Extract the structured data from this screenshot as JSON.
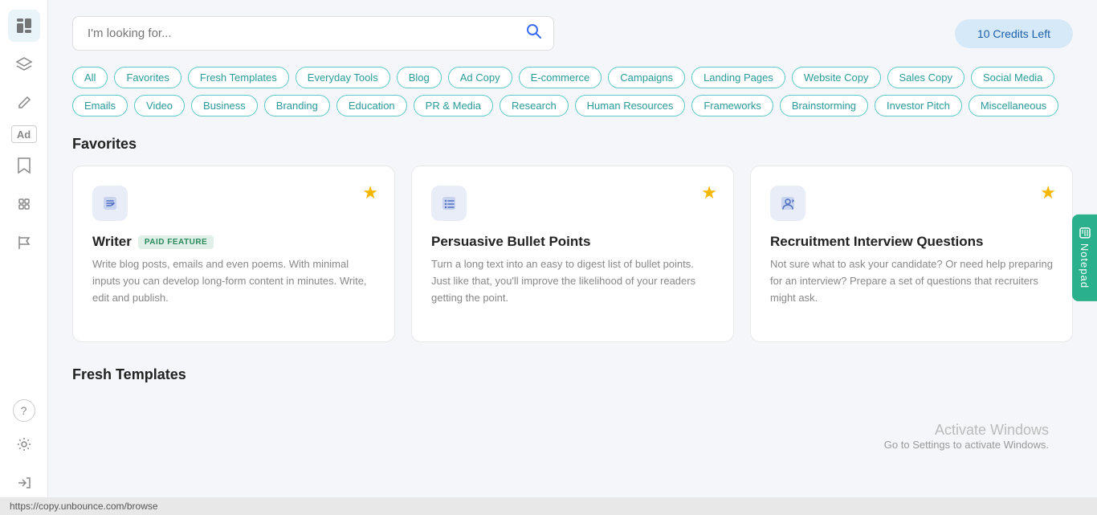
{
  "sidebar": {
    "items": [
      {
        "name": "dashboard-icon",
        "icon": "☰",
        "active": true,
        "label": "Dashboard"
      },
      {
        "name": "layers-icon",
        "icon": "⊞",
        "active": false,
        "label": "Layers"
      },
      {
        "name": "edit-icon",
        "icon": "✏️",
        "active": false,
        "label": "Edit"
      },
      {
        "name": "ad-icon",
        "icon": "Ad",
        "active": false,
        "label": "Ad"
      },
      {
        "name": "bookmark-icon",
        "icon": "🔖",
        "active": false,
        "label": "Bookmark"
      },
      {
        "name": "plugin-icon",
        "icon": "🧩",
        "active": false,
        "label": "Plugin"
      },
      {
        "name": "flag-icon",
        "icon": "🚩",
        "active": false,
        "label": "Flag"
      }
    ],
    "bottom_items": [
      {
        "name": "help-icon",
        "icon": "?",
        "label": "Help"
      },
      {
        "name": "settings-icon",
        "icon": "⚙",
        "label": "Settings"
      },
      {
        "name": "logout-icon",
        "icon": "→",
        "label": "Logout"
      }
    ]
  },
  "search": {
    "placeholder": "I'm looking for...",
    "value": ""
  },
  "credits": {
    "label": "10 Credits Left"
  },
  "filter_tags": [
    {
      "id": "all",
      "label": "All",
      "active": false
    },
    {
      "id": "favorites",
      "label": "Favorites",
      "active": false
    },
    {
      "id": "fresh-templates",
      "label": "Fresh Templates",
      "active": false
    },
    {
      "id": "everyday-tools",
      "label": "Everyday Tools",
      "active": false
    },
    {
      "id": "blog",
      "label": "Blog",
      "active": false
    },
    {
      "id": "ad-copy",
      "label": "Ad Copy",
      "active": false
    },
    {
      "id": "e-commerce",
      "label": "E-commerce",
      "active": false
    },
    {
      "id": "campaigns",
      "label": "Campaigns",
      "active": false
    },
    {
      "id": "landing-pages",
      "label": "Landing Pages",
      "active": false
    },
    {
      "id": "website-copy",
      "label": "Website Copy",
      "active": false
    },
    {
      "id": "sales-copy",
      "label": "Sales Copy",
      "active": false
    },
    {
      "id": "social-media",
      "label": "Social Media",
      "active": false
    },
    {
      "id": "emails",
      "label": "Emails",
      "active": false
    },
    {
      "id": "video",
      "label": "Video",
      "active": false
    },
    {
      "id": "business",
      "label": "Business",
      "active": false
    },
    {
      "id": "branding",
      "label": "Branding",
      "active": false
    },
    {
      "id": "education",
      "label": "Education",
      "active": false
    },
    {
      "id": "pr-media",
      "label": "PR & Media",
      "active": false
    },
    {
      "id": "research",
      "label": "Research",
      "active": false
    },
    {
      "id": "human-resources",
      "label": "Human Resources",
      "active": false
    },
    {
      "id": "frameworks",
      "label": "Frameworks",
      "active": false
    },
    {
      "id": "brainstorming",
      "label": "Brainstorming",
      "active": false
    },
    {
      "id": "investor-pitch",
      "label": "Investor Pitch",
      "active": false
    },
    {
      "id": "miscellaneous",
      "label": "Miscellaneous",
      "active": false
    }
  ],
  "sections": [
    {
      "id": "favorites",
      "heading": "Favorites",
      "cards": [
        {
          "id": "writer",
          "icon": "✏",
          "icon_color": "#5070c0",
          "title": "Writer",
          "paid": true,
          "paid_label": "PAID FEATURE",
          "desc": "Write blog posts, emails and even poems. With minimal inputs you can develop long-form content in minutes. Write, edit and publish.",
          "starred": true
        },
        {
          "id": "persuasive-bullet-points",
          "icon": "☰",
          "icon_color": "#5070c0",
          "title": "Persuasive Bullet Points",
          "paid": false,
          "desc": "Turn a long text into an easy to digest list of bullet points. Just like that, you'll improve the likelihood of your readers getting the point.",
          "starred": true
        },
        {
          "id": "recruitment-interview",
          "icon": "👤",
          "icon_color": "#5070c0",
          "title": "Recruitment Interview Questions",
          "paid": false,
          "desc": "Not sure what to ask your candidate? Or need help preparing for an interview? Prepare a set of questions that recruiters might ask.",
          "starred": true
        }
      ]
    },
    {
      "id": "fresh-templates",
      "heading": "Fresh Templates",
      "cards": []
    }
  ],
  "notepad": {
    "label": "Notepad"
  },
  "activate_windows": {
    "title": "Activate Windows",
    "subtitle": "Go to Settings to activate Windows."
  },
  "status_bar": {
    "url": "https://copy.unbounce.com/browse"
  }
}
